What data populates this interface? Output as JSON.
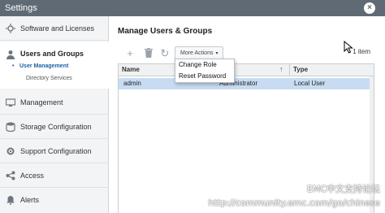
{
  "window": {
    "title": "Settings",
    "close_label": "×"
  },
  "sidebar": {
    "items": [
      {
        "label": "Software and Licenses",
        "icon": "sun-icon"
      },
      {
        "label": "Users and Groups",
        "icon": "user-icon"
      },
      {
        "label": "Management",
        "icon": "monitor-icon"
      },
      {
        "label": "Storage Configuration",
        "icon": "storage-icon"
      },
      {
        "label": "Support Configuration",
        "icon": "gear-icon"
      },
      {
        "label": "Access",
        "icon": "share-icon"
      },
      {
        "label": "Alerts",
        "icon": "bell-icon"
      }
    ],
    "subitems": [
      {
        "label": "User Management"
      },
      {
        "label": "Directory Services"
      }
    ]
  },
  "main": {
    "title": "Manage Users & Groups",
    "toolbar": {
      "add": "+",
      "delete": "🗑",
      "refresh": "↻",
      "more_actions": "More Actions",
      "more_actions_caret": "▾"
    },
    "item_count": "1 item",
    "table": {
      "columns": [
        "Name",
        "Role",
        "Type"
      ],
      "rows": [
        {
          "name": "admin",
          "role": "Administrator",
          "type": "Local User"
        }
      ]
    },
    "dropdown": {
      "items": [
        "Change Role",
        "Reset Password"
      ]
    }
  },
  "watermark": {
    "line1": "EMC中文支持论坛",
    "line2": "http://community.emc.com/go/chinese"
  }
}
